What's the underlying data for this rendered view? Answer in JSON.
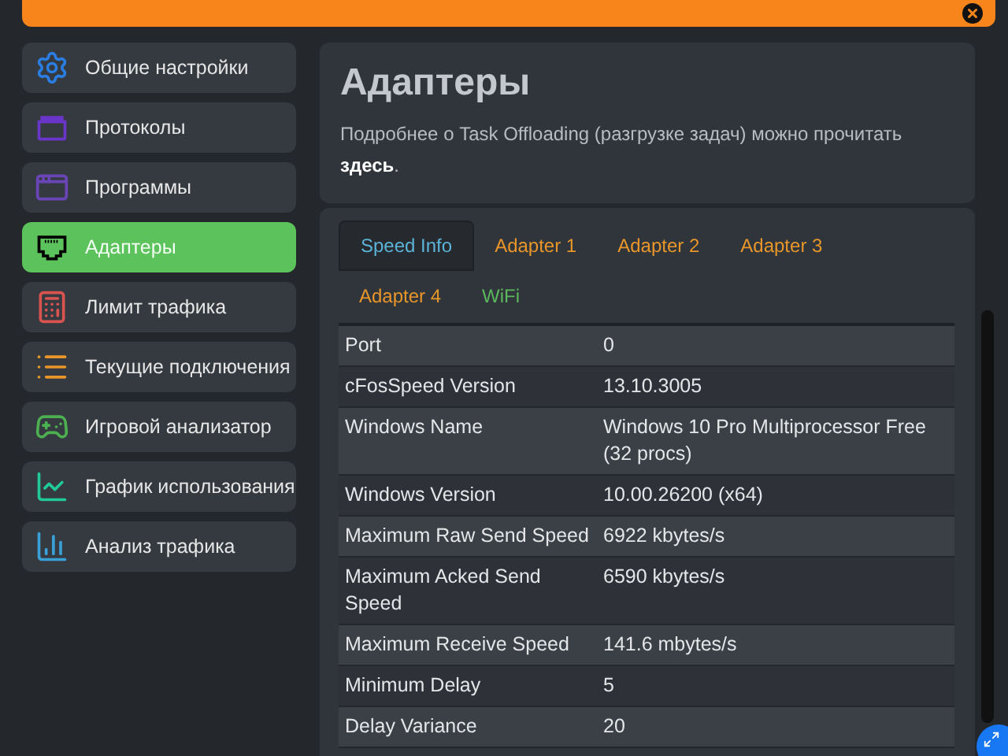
{
  "sidebar": {
    "items": [
      {
        "label": "Общие настройки",
        "selected": false
      },
      {
        "label": "Протоколы",
        "selected": false
      },
      {
        "label": "Программы",
        "selected": false
      },
      {
        "label": "Адаптеры",
        "selected": true
      },
      {
        "label": "Лимит трафика",
        "selected": false
      },
      {
        "label": "Текущие подключения",
        "selected": false
      },
      {
        "label": "Игровой анализатор",
        "selected": false
      },
      {
        "label": "График использования",
        "selected": false
      },
      {
        "label": "Анализ трафика",
        "selected": false
      }
    ]
  },
  "header": {
    "title": "Адаптеры",
    "description": "Подробнее о Task Offloading (разгрузке задач) можно прочитать",
    "link": "здесь",
    "link_suffix": "."
  },
  "tabs": [
    {
      "label": "Speed Info",
      "selected": true,
      "color": "#5bb4d8"
    },
    {
      "label": "Adapter 1",
      "selected": false,
      "color": "#e8962a"
    },
    {
      "label": "Adapter 2",
      "selected": false,
      "color": "#e8962a"
    },
    {
      "label": "Adapter 3",
      "selected": false,
      "color": "#e8962a"
    },
    {
      "label": "Adapter 4",
      "selected": false,
      "color": "#e8962a"
    },
    {
      "label": "WiFi",
      "selected": false,
      "color": "#5cb85c"
    }
  ],
  "table": {
    "rows": [
      [
        "Port",
        "0"
      ],
      [
        "cFosSpeed Version",
        "13.10.3005"
      ],
      [
        "Windows Name",
        "Windows 10 Pro Multiprocessor Free (32 procs)"
      ],
      [
        "Windows Version",
        "10.00.26200 (x64)"
      ],
      [
        "Maximum Raw Send Speed",
        "6922 kbytes/s"
      ],
      [
        "Maximum Acked Send Speed",
        "6590 kbytes/s"
      ],
      [
        "Maximum Receive Speed",
        "141.6 mbytes/s"
      ],
      [
        "Minimum Delay",
        "5"
      ],
      [
        "Delay Variance",
        "20"
      ]
    ]
  }
}
